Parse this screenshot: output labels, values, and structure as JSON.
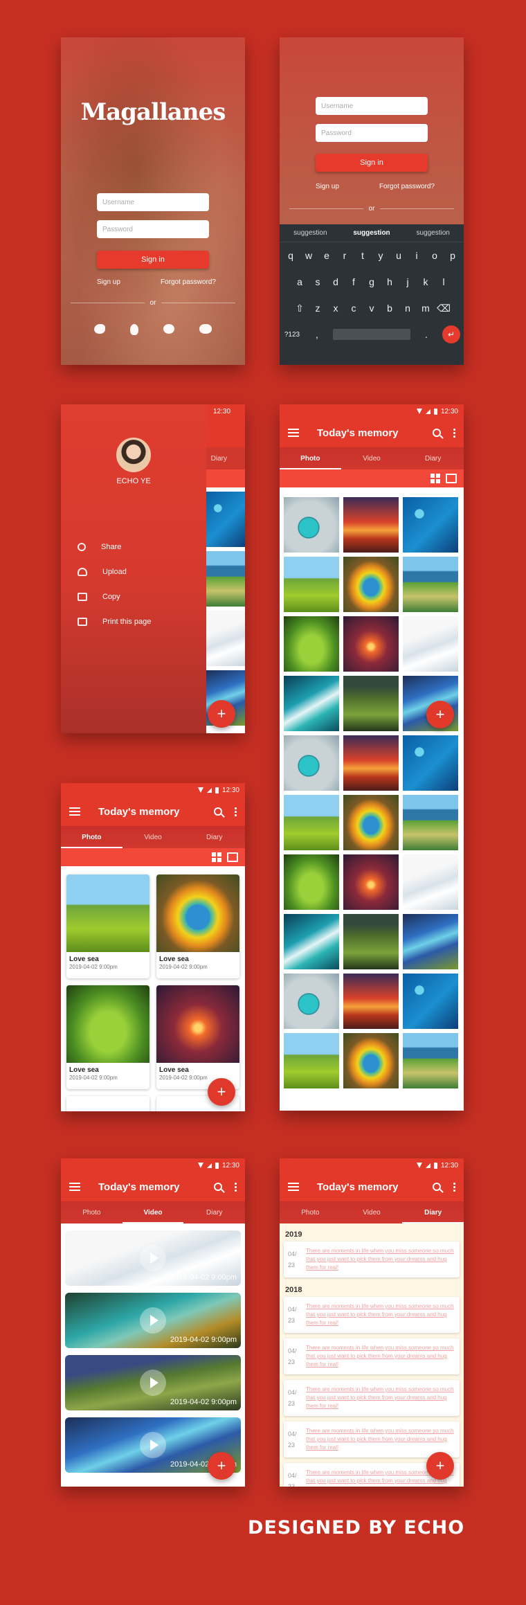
{
  "status": {
    "time": "12:30"
  },
  "login": {
    "logo": "Magallanes",
    "username_placeholder": "Username",
    "password_placeholder": "Password",
    "signin": "Sign in",
    "signup": "Sign up",
    "forgot": "Forgot password?",
    "or": "or",
    "social": [
      "twitter-icon",
      "qq-icon",
      "weibo-icon",
      "wechat-icon"
    ]
  },
  "keyboard": {
    "suggestions": [
      "suggestion",
      "suggestion",
      "suggestion"
    ],
    "row1": [
      "q",
      "w",
      "e",
      "r",
      "t",
      "y",
      "u",
      "i",
      "o",
      "p"
    ],
    "row2": [
      "a",
      "s",
      "d",
      "f",
      "g",
      "h",
      "j",
      "k",
      "l"
    ],
    "row3": [
      "z",
      "x",
      "c",
      "v",
      "b",
      "n",
      "m"
    ],
    "sym": "?123",
    "comma": ","
  },
  "drawer": {
    "user": "ECHO YE",
    "items": [
      {
        "label": "Share",
        "icon": "share-icon"
      },
      {
        "label": "Upload",
        "icon": "upload-icon"
      },
      {
        "label": "Copy",
        "icon": "copy-icon"
      },
      {
        "label": "Print this page",
        "icon": "print-icon"
      }
    ],
    "peek_tab": "Diary"
  },
  "app": {
    "title": "Today's memory",
    "tabs": [
      "Photo",
      "Video",
      "Diary"
    ]
  },
  "photos": [
    {
      "title": "Love sea",
      "date": "2019-04-02 9:00pm"
    },
    {
      "title": "Love sea",
      "date": "2019-04-02 9:00pm"
    },
    {
      "title": "Love sea",
      "date": "2019-04-02 9:00pm"
    },
    {
      "title": "Love sea",
      "date": "2019-04-02 9:00pm"
    }
  ],
  "videos": [
    {
      "date": "2019-04-02 9:00pm"
    },
    {
      "date": "2019-04-02 9:00pm"
    },
    {
      "date": "2019-04-02 9:00pm"
    },
    {
      "date": "2019-04-02 9:00pm"
    }
  ],
  "diary": {
    "years": [
      "2019",
      "2018"
    ],
    "day": "04/\n23",
    "text": "There are moments in life when you miss someone so much that you just want to pick them from your dreams and hug them for real!"
  },
  "fab": "+",
  "credit": "DESIGNED BY ECHO",
  "colors": {
    "background": "#c72f23",
    "accent": "#e2392b",
    "fab": "#e0392b"
  }
}
